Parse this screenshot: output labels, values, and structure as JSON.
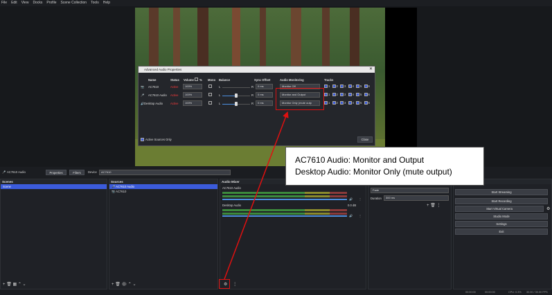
{
  "menu": [
    "File",
    "Edit",
    "View",
    "Docks",
    "Profile",
    "Scene Collection",
    "Tools",
    "Help"
  ],
  "dialog": {
    "title": "Advanced Audio Properties",
    "headers": {
      "name": "Name",
      "status": "Status",
      "volume": "Volume",
      "pct": "%",
      "mono": "Mono",
      "balance": "Balance",
      "sync": "Sync Offset",
      "monitoring": "Audio Monitoring",
      "tracks": "Tracks"
    },
    "rows": [
      {
        "name": "AC7610",
        "status": "Active",
        "volume": "100%",
        "bal_l": "L",
        "bal_r": "R",
        "sync": "0 ms",
        "monitoring": "Monitor Off"
      },
      {
        "name": "AC7610 Audio",
        "status": "Active",
        "volume": "100%",
        "bal_l": "L",
        "bal_r": "R",
        "sync": "0 ms",
        "monitoring": "Monitor and Output"
      },
      {
        "name": "Desktop Audio",
        "status": "Active",
        "volume": "100%",
        "bal_l": "L",
        "bal_r": "R",
        "sync": "0 ms",
        "monitoring": "Monitor Only (mute outp"
      }
    ],
    "track_numbers": [
      "1",
      "2",
      "3",
      "4",
      "5",
      "6"
    ],
    "active_sources_only": "Active Sources Only",
    "close": "Close"
  },
  "callout": {
    "line1": "AC7610 Audio: Monitor and Output",
    "line2": "Desktop Audio: Monitor Only (mute output)"
  },
  "context_bar": {
    "source": "AC7610 Audio",
    "properties": "Properties",
    "filters": "Filters",
    "device_label": "Device",
    "device_value": "AC7610"
  },
  "scenes": {
    "title": "Scenes",
    "items": [
      "Scene"
    ]
  },
  "sources": {
    "title": "Sources",
    "items": [
      "AC7610 Audio",
      "AC7610"
    ]
  },
  "mixer": {
    "title": "Audio Mixer",
    "channels": [
      {
        "name": "AC7610 Audio",
        "db": "0.0 dB"
      },
      {
        "name": "Desktop Audio",
        "db": "0.0 dB"
      }
    ],
    "scale": [
      "-60",
      "-55",
      "-50",
      "-45",
      "-40",
      "-35",
      "-30",
      "-25",
      "-20",
      "-15",
      "-10",
      "-5",
      "0"
    ]
  },
  "transitions": {
    "fade": "Fade",
    "duration_label": "Duration",
    "duration_value": "300 ms"
  },
  "controls": [
    "Start Streaming",
    "Start Recording",
    "Start Virtual Camera",
    "Studio Mode",
    "Settings",
    "Exit"
  ],
  "status": {
    "cpu": "CPU: 0.3%",
    "fps": "30.00 / 30.00 FPS",
    "live": "00:00:00",
    "rec": "00:00:00"
  },
  "colors": {
    "accent": "#3b5bdb",
    "annotation": "#e01010",
    "active_status": "#ff3b3b"
  }
}
